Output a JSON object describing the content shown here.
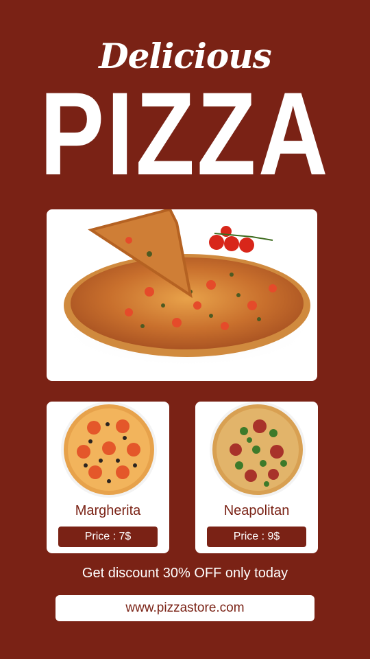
{
  "header": {
    "script_title": "Delicious",
    "big_title": "PIZZA"
  },
  "menu": [
    {
      "name": "Margherita",
      "price": "Price : 7$"
    },
    {
      "name": "Neapolitan",
      "price": "Price : 9$"
    }
  ],
  "promo": {
    "discount_text": "Get discount 30% OFF only today",
    "url": "www.pizzastore.com"
  },
  "colors": {
    "background": "#7a2215",
    "card": "#ffffff",
    "text": "#ffffff"
  }
}
